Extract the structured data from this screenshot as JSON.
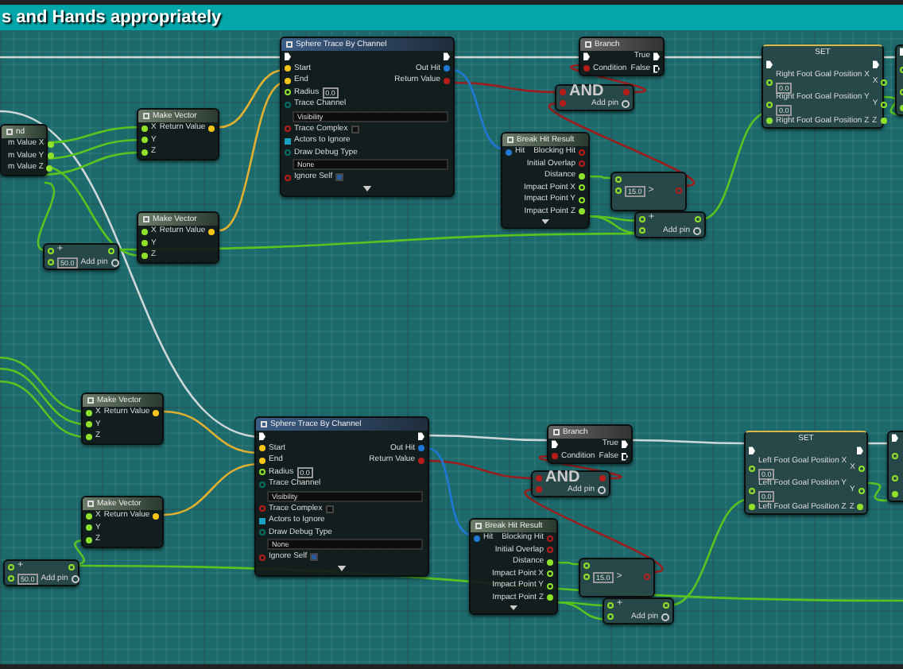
{
  "comment": {
    "title": "s and Hands appropriately"
  },
  "nodes": [
    {
      "kind": "break_clipped",
      "title": "nd",
      "outputs": [
        "m Value X",
        "m Value Y",
        "m Value Z"
      ]
    },
    {
      "kind": "make_vector",
      "title": "Make Vector",
      "inputs": [
        "X",
        "Y",
        "Z"
      ],
      "output": "Return Value"
    },
    {
      "kind": "make_vector",
      "title": "Make Vector",
      "inputs": [
        "X",
        "Y",
        "Z"
      ],
      "output": "Return Value"
    },
    {
      "kind": "add",
      "symbol": "+",
      "value": "50.0",
      "add_label": "Add pin"
    },
    {
      "kind": "trace",
      "title": "Sphere Trace By Channel",
      "start": "Start",
      "end": "End",
      "radius_label": "Radius",
      "radius": "0.0",
      "channel_label": "Trace Channel",
      "channel": "Visibility",
      "complex_label": "Trace Complex",
      "complex_checked": false,
      "actors_label": "Actors to Ignore",
      "debug_label": "Draw Debug Type",
      "debug": "None",
      "self_label": "Ignore Self",
      "self_checked": true,
      "outputs": [
        "Out Hit",
        "Return Value"
      ]
    },
    {
      "kind": "branch",
      "title": "Branch",
      "condition": "Condition",
      "true_label": "True",
      "false_label": "False"
    },
    {
      "kind": "and",
      "title": "AND",
      "add_label": "Add pin"
    },
    {
      "kind": "break_hit",
      "title": "Break Hit Result",
      "input": "Hit",
      "outputs": [
        "Blocking Hit",
        "Initial Overlap",
        "Distance",
        "Impact Point X",
        "Impact Point Y",
        "Impact Point Z"
      ]
    },
    {
      "kind": "compare",
      "symbol": ">",
      "value": "15.0"
    },
    {
      "kind": "add",
      "symbol": "+",
      "add_label": "Add pin"
    },
    {
      "kind": "set",
      "title": "SET",
      "inputs": [
        {
          "label": "Right Foot Goal Position X",
          "value": "0.0"
        },
        {
          "label": "Right Foot Goal Position Y",
          "value": "0.0"
        },
        {
          "label": "Right Foot Goal Position Z"
        }
      ],
      "outputs": [
        "X",
        "Y",
        "Z"
      ]
    },
    {
      "kind": "clipped"
    },
    {
      "kind": "make_vector",
      "title": "Make Vector",
      "inputs": [
        "X",
        "Y",
        "Z"
      ],
      "output": "Return Value"
    },
    {
      "kind": "make_vector",
      "title": "Make Vector",
      "inputs": [
        "X",
        "Y",
        "Z"
      ],
      "output": "Return Value"
    },
    {
      "kind": "add",
      "symbol": "+",
      "value": "50.0",
      "add_label": "Add pin"
    },
    {
      "kind": "trace",
      "title": "Sphere Trace By Channel",
      "start": "Start",
      "end": "End",
      "radius_label": "Radius",
      "radius": "0.0",
      "channel_label": "Trace Channel",
      "channel": "Visibility",
      "complex_label": "Trace Complex",
      "complex_checked": false,
      "actors_label": "Actors to Ignore",
      "debug_label": "Draw Debug Type",
      "debug": "None",
      "self_label": "Ignore Self",
      "self_checked": true,
      "outputs": [
        "Out Hit",
        "Return Value"
      ]
    },
    {
      "kind": "branch",
      "title": "Branch",
      "condition": "Condition",
      "true_label": "True",
      "false_label": "False"
    },
    {
      "kind": "and",
      "title": "AND",
      "add_label": "Add pin"
    },
    {
      "kind": "break_hit",
      "title": "Break Hit Result",
      "input": "Hit",
      "outputs": [
        "Blocking Hit",
        "Initial Overlap",
        "Distance",
        "Impact Point X",
        "Impact Point Y",
        "Impact Point Z"
      ]
    },
    {
      "kind": "compare",
      "symbol": ">",
      "value": "15.0"
    },
    {
      "kind": "add",
      "symbol": "+",
      "add_label": "Add pin"
    },
    {
      "kind": "set",
      "title": "SET",
      "inputs": [
        {
          "label": "Left Foot Goal Position X",
          "value": "0.0"
        },
        {
          "label": "Left Foot Goal Position Y",
          "value": "0.0"
        },
        {
          "label": "Left Foot Goal Position Z"
        }
      ],
      "outputs": [
        "X",
        "Y",
        "Z"
      ]
    },
    {
      "kind": "clipped"
    }
  ]
}
